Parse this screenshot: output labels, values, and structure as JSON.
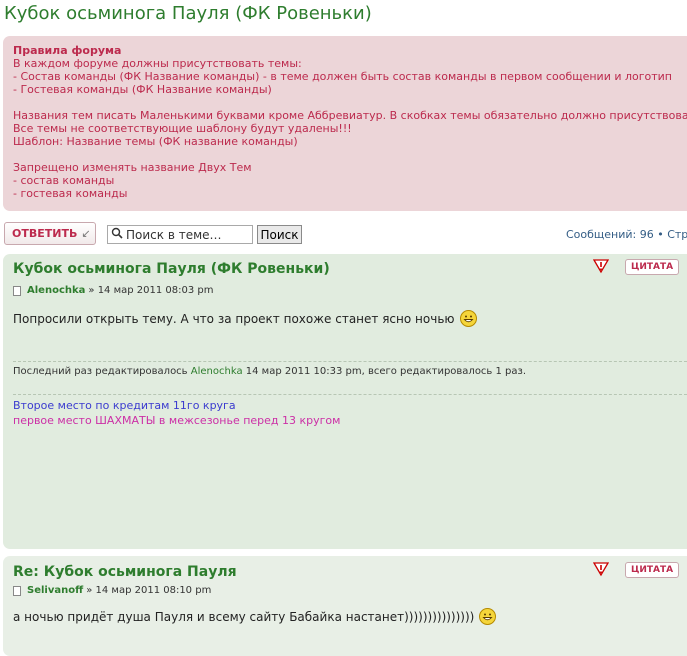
{
  "page": {
    "title": "Кубок осьминога Пауля (ФК Ровеньки)"
  },
  "rules": {
    "title": "Правила форума",
    "lines": [
      "В каждом форуме должны присутствовать темы:",
      "- Состав команды (ФК Название команды) - в теме должен быть состав команды в первом сообщении и логотип",
      "- Гостевая команды (ФК Название команды)",
      "",
      "Названия тем писать Маленькими буквами кроме Аббревиатур. В скобках темы обязательно должно присутствова",
      "Все темы не соответствующие шаблону будут удалены!!!",
      "Шаблон: Название темы (ФК название команды)",
      "",
      "Запрещено изменять название Двух Тем",
      "- состав команды",
      "- гостевая команды"
    ]
  },
  "toolbar": {
    "reply_label": "ОТВЕТИТЬ",
    "search_placeholder": "Поиск в теме…",
    "search_button": "Поиск",
    "count_text": "Сообщений: 96 • Стр"
  },
  "posts": [
    {
      "title": "Кубок осьминога Пауля (ФК Ровеньки)",
      "author": "Alenochka",
      "date": "» 14 мар 2011 08:03 pm",
      "quote_label": "ЦИТАТА",
      "content": "Попросили открыть тему. А что за проект похоже станет ясно ночью",
      "edited_prefix": "Последний раз редактировалось",
      "edited_by": "Alenochka",
      "edited_suffix": "14 мар 2011 10:33 pm, всего редактировалось 1 раз.",
      "signature": [
        "Второе место по кредитам 11го круга",
        "первое место ШАХМАТЫ в межсезонье перед 13 кругом"
      ]
    },
    {
      "title": "Re: Кубок осьминога Пауля",
      "author": "Selivanoff",
      "date": "» 14 мар 2011 08:10 pm",
      "quote_label": "ЦИТАТА",
      "content": "а ночью придёт душа Пауля и всему сайту Бабайка настанет)))))))))))))))"
    }
  ],
  "colors": {
    "title_green": "#2e7d2e",
    "rules_bg": "#ecd5d8",
    "rules_text": "#bc2a4d",
    "post_bg": "#e1ecdf",
    "sig_blue": "#3b3bcf",
    "sig_magenta": "#cc2fa6"
  },
  "icons": [
    "reply-arrow-icon",
    "search-icon",
    "document-icon",
    "report-icon",
    "grin-smiley-icon"
  ]
}
